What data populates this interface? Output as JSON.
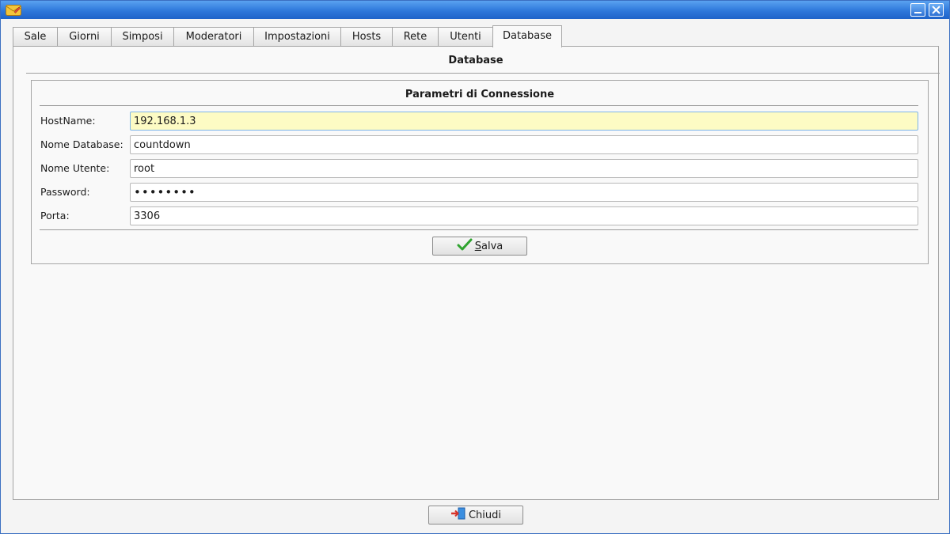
{
  "window": {
    "icon": "envelope-pencil-icon",
    "controls": {
      "minimize_icon": "minimize-icon",
      "close_icon": "close-icon"
    }
  },
  "tabs": [
    {
      "label": "Sale",
      "active": false
    },
    {
      "label": "Giorni",
      "active": false
    },
    {
      "label": "Simposi",
      "active": false
    },
    {
      "label": "Moderatori",
      "active": false
    },
    {
      "label": "Impostazioni",
      "active": false
    },
    {
      "label": "Hosts",
      "active": false
    },
    {
      "label": "Rete",
      "active": false
    },
    {
      "label": "Utenti",
      "active": false
    },
    {
      "label": "Database",
      "active": true
    }
  ],
  "panel": {
    "title": "Database",
    "group": {
      "title": "Parametri di Connessione",
      "fields": [
        {
          "label": "HostName:",
          "value": "192.168.1.3",
          "focused": true
        },
        {
          "label": "Nome Database:",
          "value": "countdown"
        },
        {
          "label": "Nome Utente:",
          "value": "root"
        },
        {
          "label": "Password:",
          "value": "••••••••",
          "masked": true
        },
        {
          "label": "Porta:",
          "value": "3306"
        }
      ],
      "save_button": {
        "label_first": "S",
        "label_rest": "alva",
        "icon": "green-check-icon"
      }
    }
  },
  "footer": {
    "close_button": {
      "label": "Chiudi",
      "icon": "exit-door-icon"
    }
  },
  "colors": {
    "titlebar": "#2e78db",
    "focused_field": "#fdfbc4",
    "check": "#2fa32f"
  }
}
